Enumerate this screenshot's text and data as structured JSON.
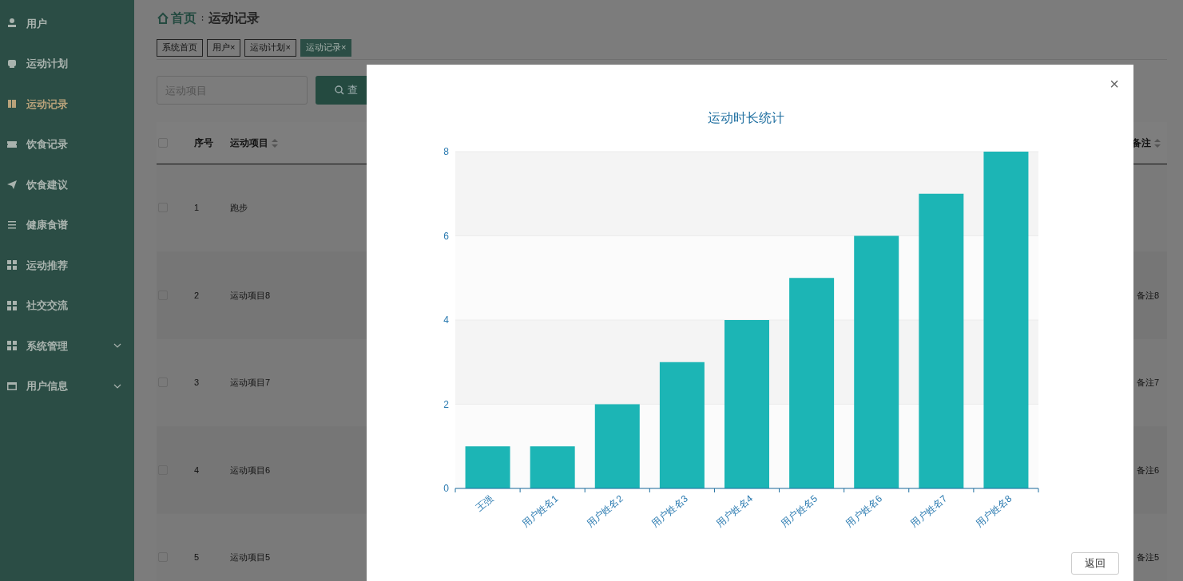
{
  "sidebar": {
    "items": [
      {
        "label": "用户",
        "selected": false,
        "expandable": false
      },
      {
        "label": "运动计划",
        "selected": false,
        "expandable": false
      },
      {
        "label": "运动记录",
        "selected": true,
        "expandable": false
      },
      {
        "label": "饮食记录",
        "selected": false,
        "expandable": false
      },
      {
        "label": "饮食建议",
        "selected": false,
        "expandable": false
      },
      {
        "label": "健康食谱",
        "selected": false,
        "expandable": false
      },
      {
        "label": "运动推荐",
        "selected": false,
        "expandable": false
      },
      {
        "label": "社交交流",
        "selected": false,
        "expandable": false
      },
      {
        "label": "系统管理",
        "selected": false,
        "expandable": true
      },
      {
        "label": "用户信息",
        "selected": false,
        "expandable": true
      }
    ]
  },
  "breadcrumb": {
    "home": "首页",
    "separator": "∶",
    "current": "运动记录"
  },
  "tabs": [
    {
      "label": "系统首页",
      "selected": false
    },
    {
      "label": "用户",
      "selected": false,
      "close": "×"
    },
    {
      "label": "运动计划",
      "selected": false,
      "close": "×"
    },
    {
      "label": "运动记录",
      "selected": true,
      "close": "×"
    }
  ],
  "search": {
    "placeholder": "运动项目",
    "button": "查"
  },
  "table": {
    "columns": [
      "序号",
      "运动项目"
    ],
    "last_column": "备注",
    "all_checked": false,
    "rows": [
      {
        "checked": false,
        "index": "1",
        "item": "跑步"
      },
      {
        "checked": false,
        "index": "2",
        "item": "运动项目8",
        "remark": "备注8"
      },
      {
        "checked": false,
        "index": "3",
        "item": "运动项目7",
        "remark": "备注7"
      },
      {
        "checked": false,
        "index": "4",
        "item": "运动项目6",
        "remark": "备注6"
      },
      {
        "checked": false,
        "index": "5",
        "item": "运动项目5",
        "remark": "备注5"
      }
    ]
  },
  "dialog": {
    "close": "×",
    "button": "返回",
    "chart_data": {
      "type": "bar",
      "title": "运动时长统计",
      "categories": [
        "王强",
        "用户姓名1",
        "用户姓名2",
        "用户姓名3",
        "用户姓名4",
        "用户姓名5",
        "用户姓名6",
        "用户姓名7",
        "用户姓名8"
      ],
      "series": [
        {
          "color": "#1cb5b5",
          "values": [
            1,
            1,
            2,
            3,
            4,
            5,
            6,
            7,
            8
          ]
        }
      ],
      "ylim": [
        0,
        8
      ],
      "yticks": [
        0,
        2,
        4,
        6,
        8
      ],
      "grid": true
    }
  }
}
